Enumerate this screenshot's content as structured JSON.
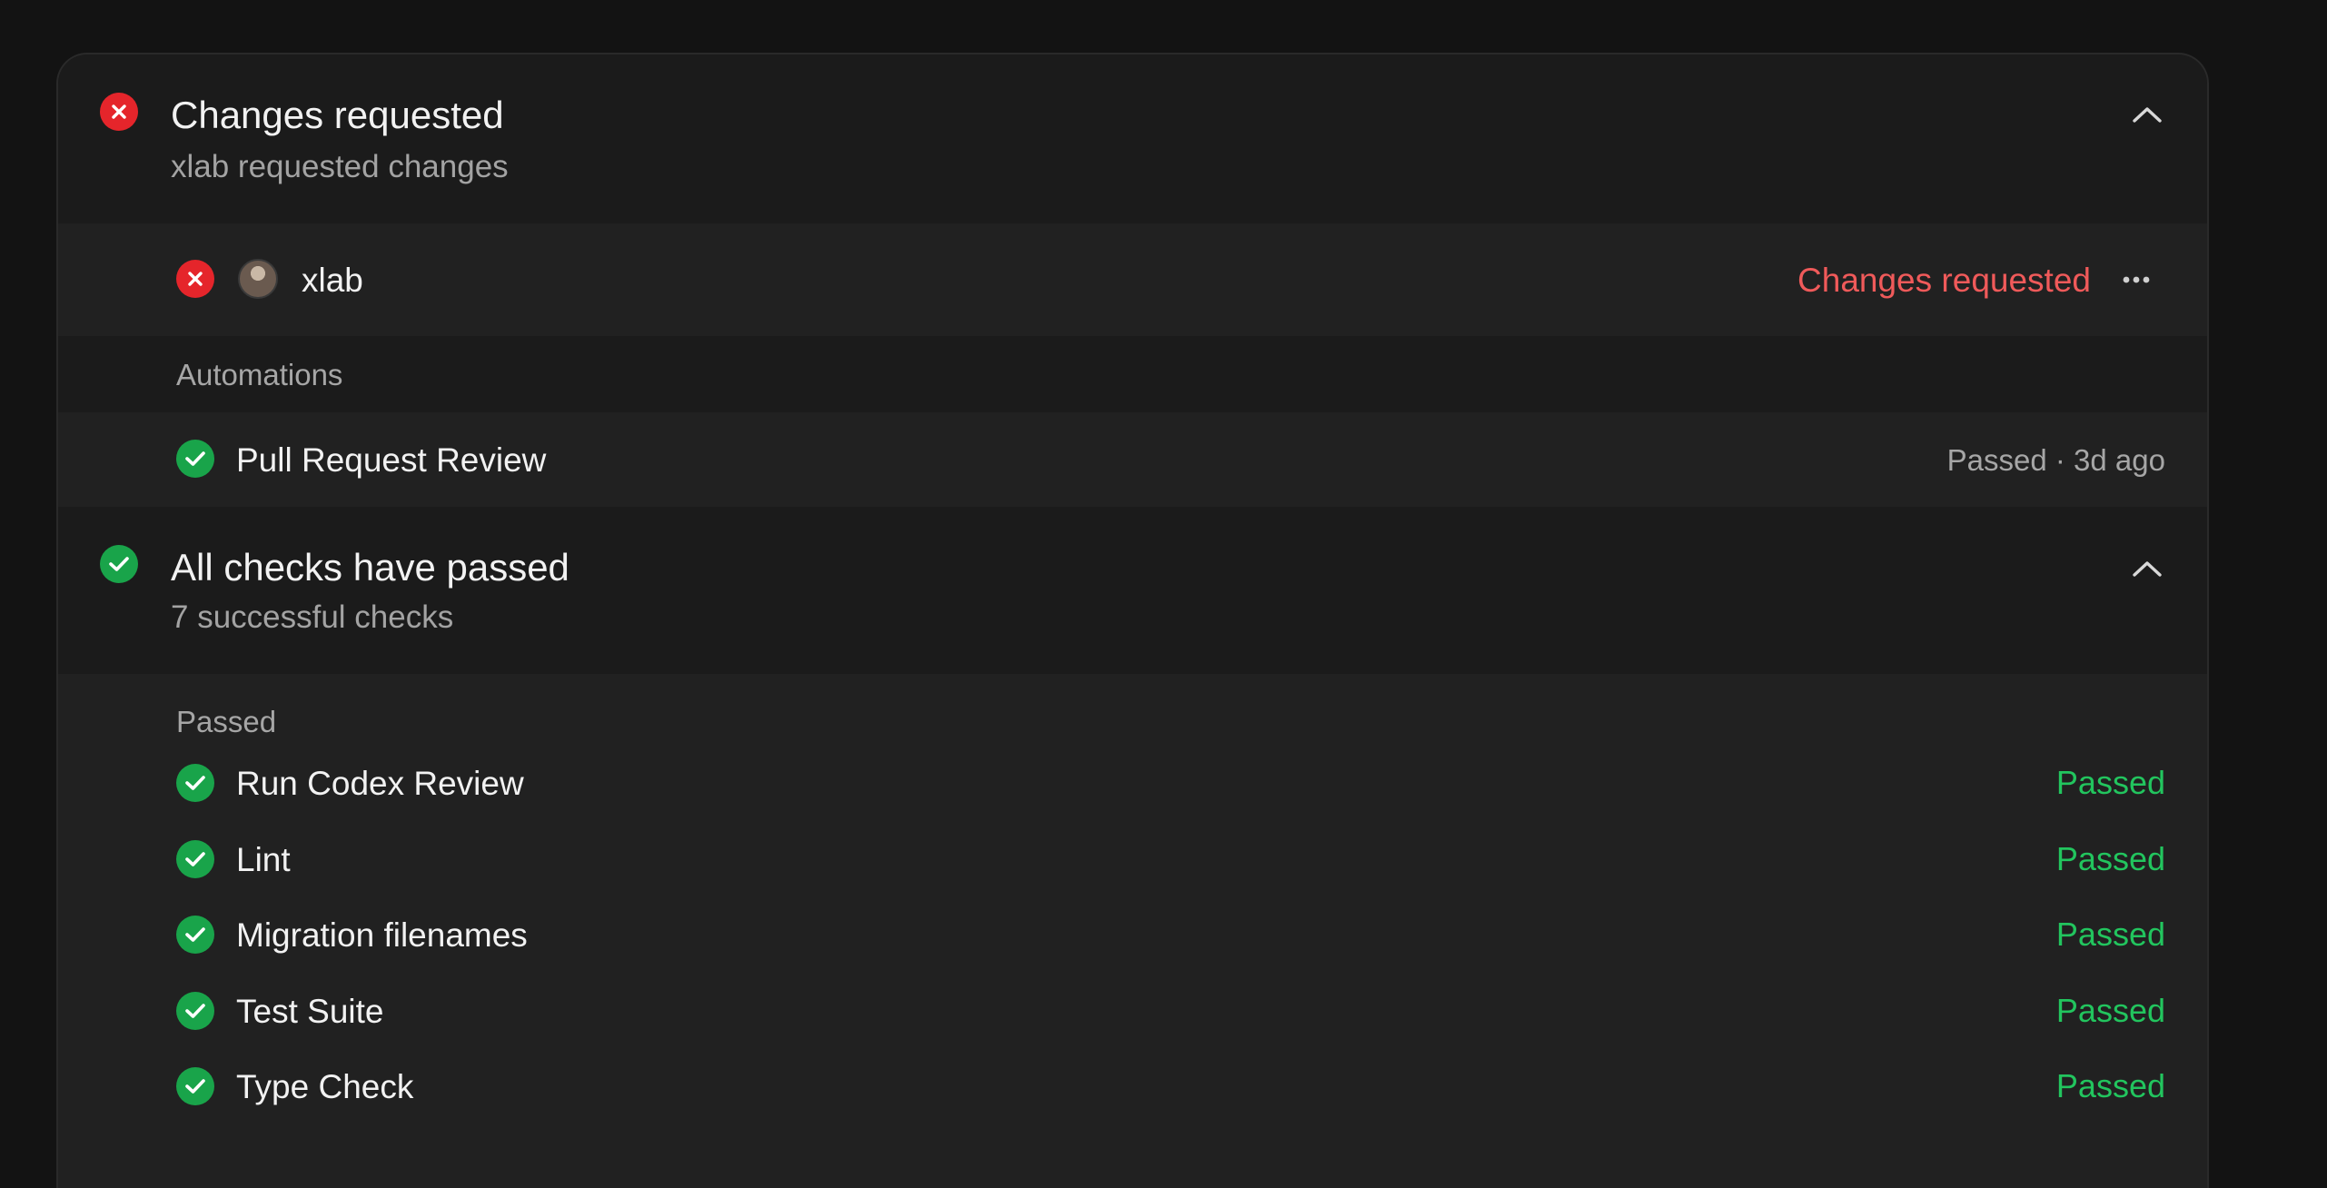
{
  "review_section": {
    "title": "Changes requested",
    "subtitle": "xlab requested changes",
    "reviewer": {
      "name": "xlab",
      "status": "Changes requested",
      "status_color": "#f05a5a"
    },
    "automations_label": "Automations",
    "automation": {
      "name": "Pull Request Review",
      "status": "Passed · 3d ago"
    }
  },
  "checks_section": {
    "title": "All checks have passed",
    "subtitle": "7 successful checks",
    "group_label": "Passed",
    "checks": [
      {
        "name": "Run Codex Review",
        "status": "Passed"
      },
      {
        "name": "Lint",
        "status": "Passed"
      },
      {
        "name": "Migration filenames",
        "status": "Passed"
      },
      {
        "name": "Test Suite",
        "status": "Passed"
      },
      {
        "name": "Type Check",
        "status": "Passed"
      }
    ]
  },
  "colors": {
    "fail": "#e5252b",
    "pass": "#19a44a",
    "passed_text": "#22c55e",
    "background": "#131313",
    "panel": "#1b1b1b",
    "row": "#212121"
  },
  "icons": {
    "fail": "x-circle-icon",
    "pass": "check-circle-icon",
    "collapse": "chevron-up-icon",
    "more": "more-horizontal-icon"
  }
}
